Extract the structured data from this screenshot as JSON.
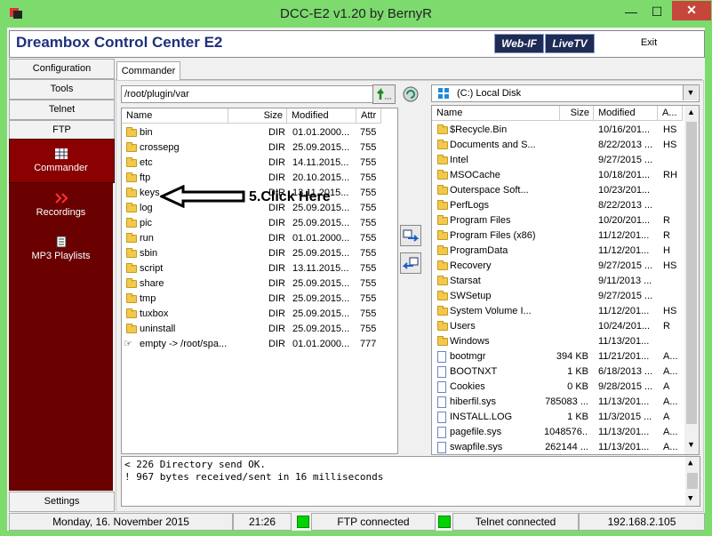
{
  "window": {
    "title": "DCC-E2 v1.20 by BernyR",
    "min": "—",
    "max": "☐",
    "close": "✕"
  },
  "banner": {
    "title": "Dreambox Control Center E2",
    "webif": "Web-IF",
    "livetv": "LiveTV",
    "exit": "Exit"
  },
  "sidebar": {
    "buttons": [
      "Configuration",
      "Tools",
      "Telnet",
      "FTP"
    ],
    "items": [
      {
        "label": "Commander",
        "icon": "grid-icon"
      },
      {
        "label": "Recordings",
        "icon": "recordings-icon"
      },
      {
        "label": "MP3 Playlists",
        "icon": "playlist-icon"
      }
    ],
    "settings": "Settings"
  },
  "tab": {
    "label": "Commander"
  },
  "left": {
    "path": "/root/plugin/var",
    "columns": [
      "Name",
      "Size",
      "Modified",
      "Attr"
    ],
    "rows": [
      {
        "name": "bin",
        "size": "DIR",
        "modified": "01.01.2000...",
        "attr": "755"
      },
      {
        "name": "crossepg",
        "size": "DIR",
        "modified": "25.09.2015...",
        "attr": "755"
      },
      {
        "name": "etc",
        "size": "DIR",
        "modified": "14.11.2015...",
        "attr": "755"
      },
      {
        "name": "ftp",
        "size": "DIR",
        "modified": "20.10.2015...",
        "attr": "755"
      },
      {
        "name": "keys",
        "size": "DIR",
        "modified": "13.11.2015...",
        "attr": "755"
      },
      {
        "name": "log",
        "size": "DIR",
        "modified": "25.09.2015...",
        "attr": "755"
      },
      {
        "name": "pic",
        "size": "DIR",
        "modified": "25.09.2015...",
        "attr": "755"
      },
      {
        "name": "run",
        "size": "DIR",
        "modified": "01.01.2000...",
        "attr": "755"
      },
      {
        "name": "sbin",
        "size": "DIR",
        "modified": "25.09.2015...",
        "attr": "755"
      },
      {
        "name": "script",
        "size": "DIR",
        "modified": "13.11.2015...",
        "attr": "755"
      },
      {
        "name": "share",
        "size": "DIR",
        "modified": "25.09.2015...",
        "attr": "755"
      },
      {
        "name": "tmp",
        "size": "DIR",
        "modified": "25.09.2015...",
        "attr": "755"
      },
      {
        "name": "tuxbox",
        "size": "DIR",
        "modified": "25.09.2015...",
        "attr": "755"
      },
      {
        "name": "uninstall",
        "size": "DIR",
        "modified": "25.09.2015...",
        "attr": "755"
      },
      {
        "name": "empty -> /root/spa...",
        "size": "DIR",
        "modified": "01.01.2000...",
        "attr": "777",
        "link": true
      }
    ]
  },
  "right": {
    "drive": "(C:)  Local Disk",
    "columns": [
      "Name",
      "Size",
      "Modified",
      "A..."
    ],
    "rows": [
      {
        "name": "$Recycle.Bin",
        "size": "",
        "modified": "10/16/201...",
        "attr": "HS",
        "type": "folder"
      },
      {
        "name": "Documents and S...",
        "size": "",
        "modified": "8/22/2013 ...",
        "attr": "HS",
        "type": "folder"
      },
      {
        "name": "Intel",
        "size": "",
        "modified": "9/27/2015 ...",
        "attr": "",
        "type": "folder"
      },
      {
        "name": "MSOCache",
        "size": "",
        "modified": "10/18/201...",
        "attr": "RH",
        "type": "folder"
      },
      {
        "name": "Outerspace Soft...",
        "size": "",
        "modified": "10/23/201...",
        "attr": "",
        "type": "folder"
      },
      {
        "name": "PerfLogs",
        "size": "",
        "modified": "8/22/2013 ...",
        "attr": "",
        "type": "folder"
      },
      {
        "name": "Program Files",
        "size": "",
        "modified": "10/20/201...",
        "attr": "R",
        "type": "folder"
      },
      {
        "name": "Program Files (x86)",
        "size": "",
        "modified": "11/12/201...",
        "attr": "R",
        "type": "folder"
      },
      {
        "name": "ProgramData",
        "size": "",
        "modified": "11/12/201...",
        "attr": "H",
        "type": "folder"
      },
      {
        "name": "Recovery",
        "size": "",
        "modified": "9/27/2015 ...",
        "attr": "HS",
        "type": "folder"
      },
      {
        "name": "Starsat",
        "size": "",
        "modified": "9/11/2013 ...",
        "attr": "",
        "type": "folder"
      },
      {
        "name": "SWSetup",
        "size": "",
        "modified": "9/27/2015 ...",
        "attr": "",
        "type": "folder"
      },
      {
        "name": "System Volume I...",
        "size": "",
        "modified": "11/12/201...",
        "attr": "HS",
        "type": "folder"
      },
      {
        "name": "Users",
        "size": "",
        "modified": "10/24/201...",
        "attr": "R",
        "type": "folder"
      },
      {
        "name": "Windows",
        "size": "",
        "modified": "11/13/201...",
        "attr": "",
        "type": "folder"
      },
      {
        "name": "bootmgr",
        "size": "394 KB",
        "modified": "11/21/201...",
        "attr": "A...",
        "type": "file"
      },
      {
        "name": "BOOTNXT",
        "size": "1 KB",
        "modified": "6/18/2013 ...",
        "attr": "A...",
        "type": "file"
      },
      {
        "name": "Cookies",
        "size": "0 KB",
        "modified": "9/28/2015 ...",
        "attr": "A",
        "type": "file"
      },
      {
        "name": "hiberfil.sys",
        "size": "785083 ...",
        "modified": "11/13/201...",
        "attr": "A...",
        "type": "file"
      },
      {
        "name": "INSTALL.LOG",
        "size": "1 KB",
        "modified": "11/3/2015 ...",
        "attr": "A",
        "type": "file"
      },
      {
        "name": "pagefile.sys",
        "size": "1048576...",
        "modified": "11/13/201...",
        "attr": "A...",
        "type": "file"
      },
      {
        "name": "swapfile.sys",
        "size": "262144 ...",
        "modified": "11/13/201...",
        "attr": "A...",
        "type": "file"
      }
    ]
  },
  "log": [
    "< 226 Directory send OK.",
    "! 967 bytes received/sent in 16 milliseconds"
  ],
  "annotation": "5.Click Here",
  "status": {
    "date": "Monday, 16. November 2015",
    "time": "21:26",
    "ftp": "FTP connected",
    "telnet": "Telnet connected",
    "ip": "192.168.2.105"
  }
}
